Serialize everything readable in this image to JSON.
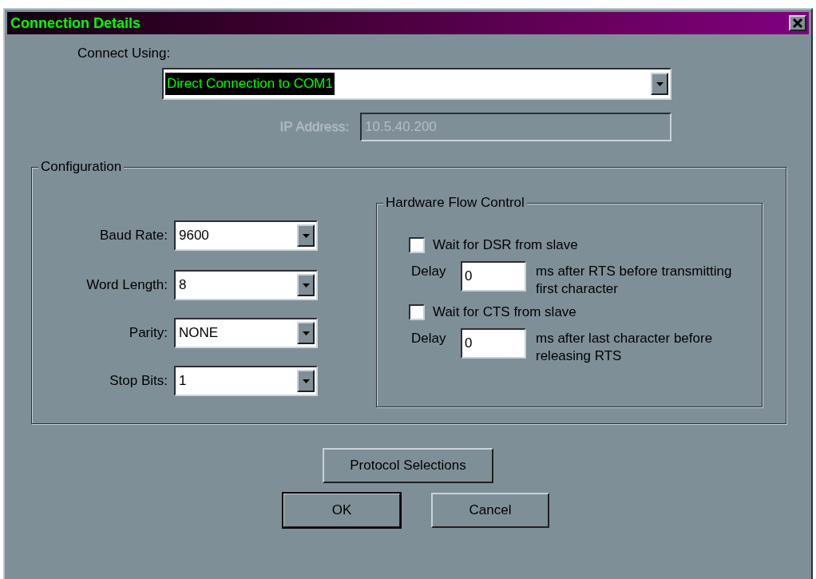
{
  "window": {
    "title": "Connection Details"
  },
  "connect_using": {
    "label": "Connect Using:",
    "value": "Direct Connection to COM1",
    "highlighted": true
  },
  "ip_address": {
    "label": "IP Address:",
    "value": "10.5.40.200",
    "disabled": true
  },
  "configuration": {
    "title": "Configuration",
    "fields": [
      {
        "label": "Baud Rate:",
        "value": "9600"
      },
      {
        "label": "Word Length:",
        "value": "8"
      },
      {
        "label": "Parity:",
        "value": "NONE"
      },
      {
        "label": "Stop Bits:",
        "value": "1"
      }
    ]
  },
  "hardware_flow_control": {
    "title": "Hardware Flow Control",
    "options": [
      {
        "label": "Wait for DSR from slave",
        "checked": false,
        "delay_label": "Delay",
        "delay_value": "0",
        "note": "ms after RTS before transmitting first character"
      },
      {
        "label": "Wait for CTS from slave",
        "checked": false,
        "delay_label": "Delay",
        "delay_value": "0",
        "note": "ms after last character before releasing RTS"
      }
    ]
  },
  "buttons": [
    {
      "label": "Protocol Selections",
      "default": false
    },
    {
      "label": "OK",
      "default": true
    },
    {
      "label": "Cancel",
      "default": false
    }
  ]
}
